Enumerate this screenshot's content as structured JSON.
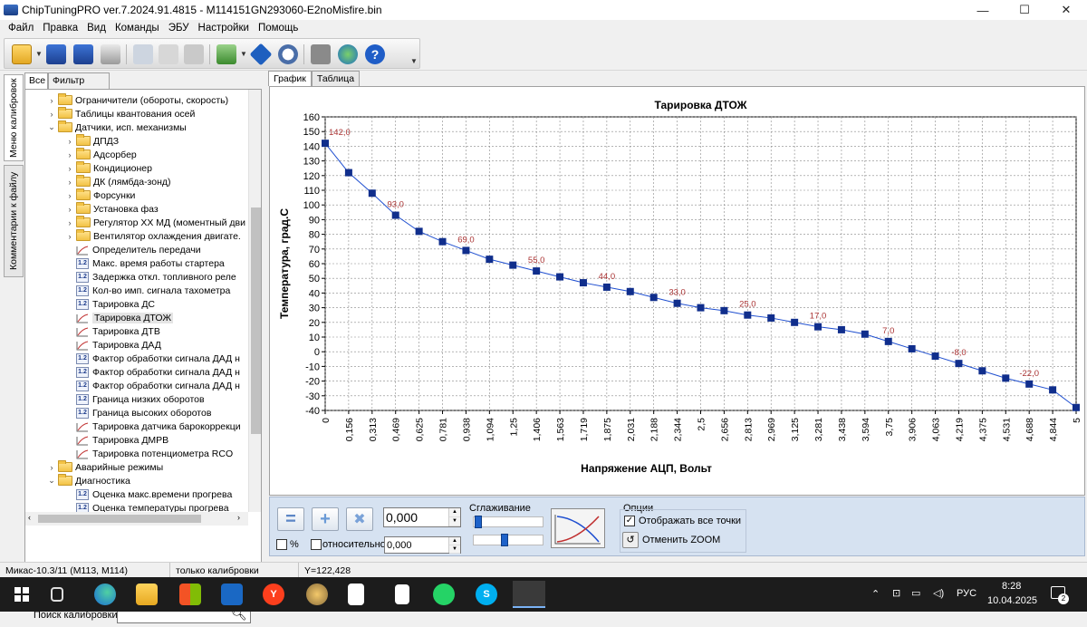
{
  "window": {
    "title": "ChipTuningPRO ver.7.2024.91.4815  -  M114151GN293060-E2noMisfire.bin",
    "controls": {
      "minimize": "—",
      "maximize": "☐",
      "close": "✕"
    }
  },
  "menu": [
    "Файл",
    "Правка",
    "Вид",
    "Команды",
    "ЭБУ",
    "Настройки",
    "Помощь"
  ],
  "vertical_tabs": [
    "Меню калибровок",
    "Комментарии к файлу"
  ],
  "left_tabs": [
    "Все",
    "Фильтр"
  ],
  "tree": [
    {
      "indent": 1,
      "type": "folder",
      "expand": "›",
      "label": "Ограничители (обороты, скорость)"
    },
    {
      "indent": 1,
      "type": "folder",
      "expand": "›",
      "label": "Таблицы квантования осей"
    },
    {
      "indent": 1,
      "type": "folder",
      "expand": "⌄",
      "label": "Датчики, исп. механизмы"
    },
    {
      "indent": 2,
      "type": "folder",
      "expand": "›",
      "label": "ДПДЗ"
    },
    {
      "indent": 2,
      "type": "folder",
      "expand": "›",
      "label": "Адсорбер"
    },
    {
      "indent": 2,
      "type": "folder",
      "expand": "›",
      "label": "Кондиционер"
    },
    {
      "indent": 2,
      "type": "folder",
      "expand": "›",
      "label": "ДК (лямбда-зонд)"
    },
    {
      "indent": 2,
      "type": "folder",
      "expand": "›",
      "label": "Форсунки"
    },
    {
      "indent": 2,
      "type": "folder",
      "expand": "›",
      "label": "Установка фаз"
    },
    {
      "indent": 2,
      "type": "folder",
      "expand": "›",
      "label": "Регулятор ХХ МД (моментный дви"
    },
    {
      "indent": 2,
      "type": "folder",
      "expand": "›",
      "label": "Вентилятор охлаждения двигате."
    },
    {
      "indent": 2,
      "type": "curve",
      "expand": "",
      "label": "Определитель передачи"
    },
    {
      "indent": 2,
      "type": "num",
      "expand": "",
      "label": "Макс. время работы стартера"
    },
    {
      "indent": 2,
      "type": "num",
      "expand": "",
      "label": "Задержка откл. топливного реле"
    },
    {
      "indent": 2,
      "type": "num",
      "expand": "",
      "label": "Кол-во имп. сигнала тахометра"
    },
    {
      "indent": 2,
      "type": "num",
      "expand": "",
      "label": "Тарировка ДС"
    },
    {
      "indent": 2,
      "type": "curve",
      "expand": "",
      "label": "Тарировка ДТОЖ",
      "selected": true
    },
    {
      "indent": 2,
      "type": "curve",
      "expand": "",
      "label": "Тарировка ДТВ"
    },
    {
      "indent": 2,
      "type": "curve",
      "expand": "",
      "label": "Тарировка ДАД"
    },
    {
      "indent": 2,
      "type": "num",
      "expand": "",
      "label": "Фактор обработки сигнала ДАД н"
    },
    {
      "indent": 2,
      "type": "num",
      "expand": "",
      "label": "Фактор обработки сигнала ДАД н"
    },
    {
      "indent": 2,
      "type": "num",
      "expand": "",
      "label": "Фактор обработки сигнала ДАД н"
    },
    {
      "indent": 2,
      "type": "num",
      "expand": "",
      "label": "Граница низких оборотов"
    },
    {
      "indent": 2,
      "type": "num",
      "expand": "",
      "label": "Граница высоких оборотов"
    },
    {
      "indent": 2,
      "type": "curve",
      "expand": "",
      "label": "Тарировка датчика барокоррекци"
    },
    {
      "indent": 2,
      "type": "curve",
      "expand": "",
      "label": "Тарировка ДМРВ"
    },
    {
      "indent": 2,
      "type": "curve",
      "expand": "",
      "label": "Тарировка потенциометра RCO"
    },
    {
      "indent": 1,
      "type": "folder",
      "expand": "›",
      "label": "Аварийные режимы"
    },
    {
      "indent": 1,
      "type": "folder",
      "expand": "⌄",
      "label": "Диагностика"
    },
    {
      "indent": 2,
      "type": "num",
      "expand": "",
      "label": "Оценка макс.времени прогрева"
    },
    {
      "indent": 2,
      "type": "num",
      "expand": "",
      "label": "Оценка температуры прогрева"
    }
  ],
  "search": {
    "label": "Поиск калибровки",
    "value": ""
  },
  "right_tabs": [
    "График",
    "Таблица"
  ],
  "chart_data": {
    "type": "line",
    "title": "Тарировка ДТОЖ",
    "xlabel": "Напряжение АЦП, Вольт",
    "ylabel": "Температура, град.С",
    "ylim": [
      -40,
      160
    ],
    "yticks": [
      160,
      150,
      140,
      130,
      120,
      110,
      100,
      90,
      80,
      70,
      60,
      50,
      40,
      30,
      20,
      10,
      0,
      -10,
      -20,
      -30,
      -40
    ],
    "x": [
      "0",
      "0,156",
      "0,313",
      "0,469",
      "0,625",
      "0,781",
      "0,938",
      "1,094",
      "1,25",
      "1,406",
      "1,563",
      "1,719",
      "1,875",
      "2,031",
      "2,188",
      "2,344",
      "2,5",
      "2,656",
      "2,813",
      "2,969",
      "3,125",
      "3,281",
      "3,438",
      "3,594",
      "3,75",
      "3,906",
      "4,063",
      "4,219",
      "4,375",
      "4,531",
      "4,688",
      "4,844",
      "5"
    ],
    "values": [
      142,
      122,
      108,
      93,
      82,
      75,
      69,
      63,
      59,
      55,
      51,
      47,
      44,
      41,
      37,
      33,
      30,
      28,
      25,
      23,
      20,
      17,
      15,
      12,
      7,
      2,
      -3,
      -8,
      -13,
      -18,
      -22,
      -26,
      -38
    ],
    "data_labels": [
      {
        "i": 0,
        "text": "142,0"
      },
      {
        "i": 3,
        "text": "93,0"
      },
      {
        "i": 6,
        "text": "69,0"
      },
      {
        "i": 9,
        "text": "55,0"
      },
      {
        "i": 12,
        "text": "44,0"
      },
      {
        "i": 15,
        "text": "33,0"
      },
      {
        "i": 18,
        "text": "25,0"
      },
      {
        "i": 21,
        "text": "17,0"
      },
      {
        "i": 24,
        "text": "7,0"
      },
      {
        "i": 27,
        "text": "-8,0"
      },
      {
        "i": 30,
        "text": "-22,0"
      }
    ],
    "grid": true,
    "line_color": "#1f4fd0",
    "marker_color": "#102e8c",
    "label_color": "#a33"
  },
  "controls": {
    "value1": "0,000",
    "value2": "0,000",
    "percent_label": "%",
    "relative_label": "относительно",
    "smoothing_label": "Сглаживание",
    "options_label": "Опции",
    "show_all_points": "Отображать все точки",
    "cancel_zoom": "Отменить ZOOM",
    "btn_equal": "=",
    "btn_plus": "+",
    "btn_multiply": "✖"
  },
  "status": [
    "Микас-10.3/11 (M113, M114)",
    "только калибровки",
    "Y=122,428"
  ],
  "tray": {
    "lang": "РУС",
    "time": "8:28",
    "date": "10.04.2025",
    "notifications": "2"
  }
}
